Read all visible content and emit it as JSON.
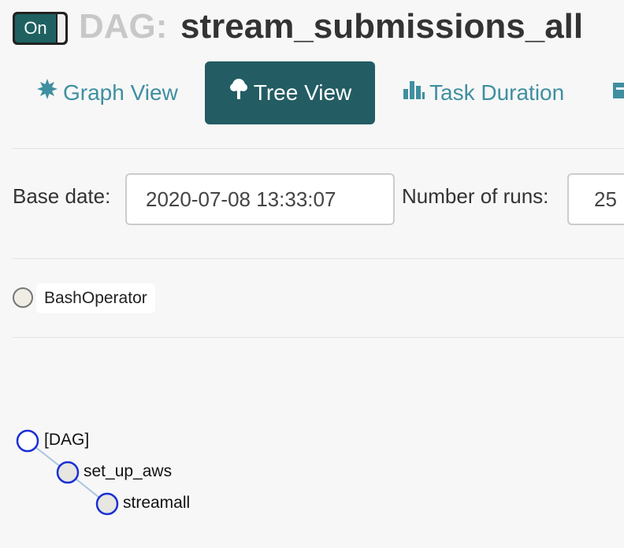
{
  "header": {
    "toggle_label": "On",
    "title_prefix": "DAG:",
    "dag_id": "stream_submissions_all"
  },
  "tabs": [
    {
      "label": "Graph View",
      "icon": "graph-icon",
      "active": false
    },
    {
      "label": "Tree View",
      "icon": "tree-icon",
      "active": true
    },
    {
      "label": "Task Duration",
      "icon": "bar-chart-icon",
      "active": false
    }
  ],
  "form": {
    "base_date_label": "Base date:",
    "base_date_value": "2020-07-08 13:33:07",
    "num_runs_label": "Number of runs:",
    "num_runs_value": "25"
  },
  "legend": {
    "operator_label": "BashOperator"
  },
  "tree": {
    "nodes": [
      {
        "label": "[DAG]"
      },
      {
        "label": "set_up_aws"
      },
      {
        "label": "streamall"
      }
    ]
  },
  "colors": {
    "accent": "#235c63",
    "tab_text": "#3f8fa0",
    "toggle_on": "#1f6161",
    "node_stroke": "#1a2fd6",
    "link": "#a8c4e0",
    "operator_fill": "#f0ede4"
  }
}
